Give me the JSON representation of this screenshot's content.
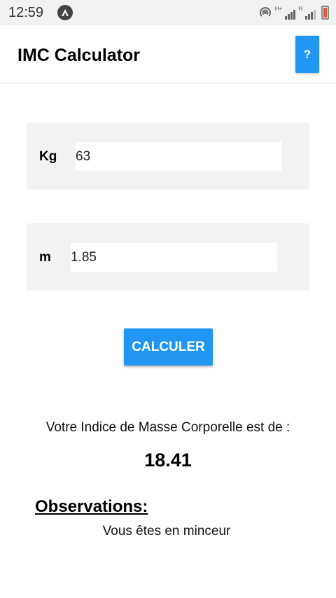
{
  "status_bar": {
    "time": "12:59",
    "signal_label_1": "H+",
    "signal_label_2": "H",
    "battery_color": "#e05a3a"
  },
  "app_bar": {
    "title": "IMC Calculator",
    "help_label": "?",
    "accent_color": "#2196f3"
  },
  "form": {
    "weight_label": "Kg",
    "weight_value": "63",
    "height_label": "m",
    "height_value": "1.85",
    "calculate_label": "CALCULER"
  },
  "result": {
    "label": "Votre Indice de Masse Corporelle est de :",
    "value": "18.41"
  },
  "observations": {
    "title": "Observations:",
    "text": "Vous êtes en minceur"
  }
}
